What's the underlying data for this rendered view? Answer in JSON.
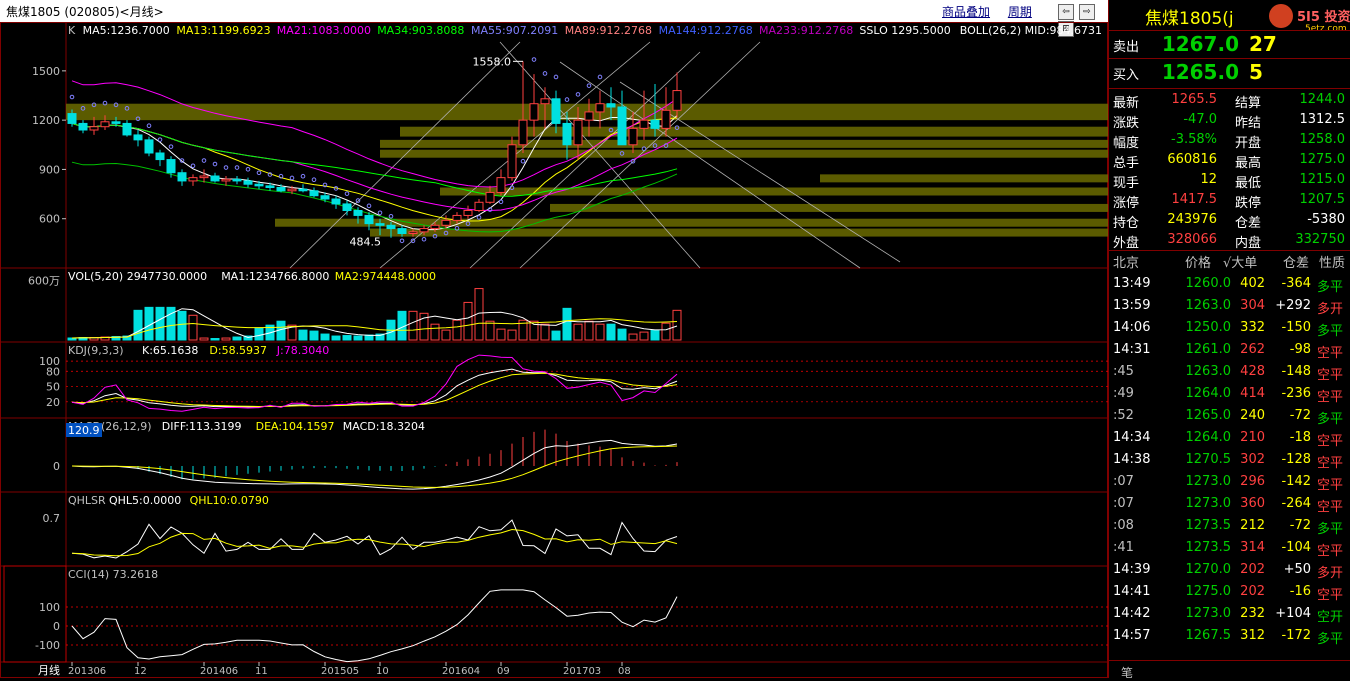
{
  "window": {
    "title": "焦煤1805 (020805)<月线>",
    "links": [
      "商品叠加",
      "周期"
    ],
    "nav_buttons": [
      "⇦",
      "⇨",
      "⊞"
    ]
  },
  "panels": {
    "main": {
      "legend": [
        {
          "text": "K",
          "color": "#c0c0c0"
        },
        {
          "text": "MA5:1236.7000",
          "color": "#ffffff"
        },
        {
          "text": "MA13:1199.6923",
          "color": "#ffff00"
        },
        {
          "text": "MA21:1083.0000",
          "color": "#ff00ff"
        },
        {
          "text": "MA34:903.8088",
          "color": "#00ff00"
        },
        {
          "text": "MA55:907.2091",
          "color": "#8080ff"
        },
        {
          "text": "MA89:912.2768",
          "color": "#ff8080"
        },
        {
          "text": "MA144:912.2768",
          "color": "#4060ff"
        },
        {
          "text": "MA233:912.2768",
          "color": "#c000c0"
        },
        {
          "text": "SSLO 1295.5000",
          "color": "#ffffff"
        },
        {
          "text": "BOLL(26,2) MID:984.6731",
          "color": "#ffffff"
        }
      ],
      "yticks": [
        "1500",
        "1200",
        "900",
        "600"
      ],
      "annotations": {
        "high": "1558.0",
        "low": "484.5"
      }
    },
    "vol": {
      "legend": [
        {
          "text": "VOL(5,20) 2947730.0000",
          "color": "#ffffff"
        },
        {
          "text": "MA1:1234766.8000",
          "color": "#ffffff"
        },
        {
          "text": "MA2:974448.0000",
          "color": "#ffff00"
        }
      ],
      "ytick": "600万"
    },
    "kdj": {
      "legend": [
        {
          "text": "KDJ(9,3,3)",
          "color": "#c0c0c0"
        },
        {
          "text": "K:65.1638",
          "color": "#ffffff"
        },
        {
          "text": "D:58.5937",
          "color": "#ffff00"
        },
        {
          "text": "J:78.3040",
          "color": "#ff00ff"
        }
      ],
      "yticks": [
        "100",
        "80",
        "50",
        "20"
      ]
    },
    "macd": {
      "legend": [
        {
          "text": "MACD(26,12,9)",
          "color": "#c0c0c0"
        },
        {
          "text": "DIFF:113.3199",
          "color": "#ffffff"
        },
        {
          "text": "DEA:104.1597",
          "color": "#ffff00"
        },
        {
          "text": "MACD:18.3204",
          "color": "#ffffff"
        }
      ],
      "yticks": [
        "0"
      ],
      "cursor_value": "120.9"
    },
    "qhlsr": {
      "legend": [
        {
          "text": "QHLSR",
          "color": "#c0c0c0"
        },
        {
          "text": "QHL5:0.0000",
          "color": "#ffffff"
        },
        {
          "text": "QHL10:0.0790",
          "color": "#ffff00"
        }
      ],
      "yticks": [
        "0.7"
      ]
    },
    "cci": {
      "legend": [
        {
          "text": "CCI(14) 73.2618",
          "color": "#c0c0c0"
        }
      ],
      "yticks": [
        "100",
        "0",
        "-100"
      ]
    }
  },
  "xaxis": {
    "period_label": "月线",
    "labels": [
      "201306",
      "12",
      "201406",
      "11",
      "201505",
      "10",
      "201604",
      "09",
      "201703",
      "08"
    ]
  },
  "quote": {
    "name": "焦煤1805(j",
    "brand": "5I5 投资",
    "brand_sub": "5etz.com",
    "sell_label": "卖出",
    "sell_price": "1267.0",
    "sell_vol": "27",
    "buy_label": "买入",
    "buy_price": "1265.0",
    "buy_vol": "5",
    "stats": [
      {
        "l1": "最新",
        "v1": "1265.5",
        "c1": "#ff4040",
        "l2": "结算",
        "v2": "1244.0",
        "c2": "#00d000"
      },
      {
        "l1": "涨跌",
        "v1": "-47.0",
        "c1": "#00d000",
        "l2": "昨结",
        "v2": "1312.5",
        "c2": "#ffffff"
      },
      {
        "l1": "幅度",
        "v1": "-3.58%",
        "c1": "#00d000",
        "l2": "开盘",
        "v2": "1258.0",
        "c2": "#00d000"
      },
      {
        "l1": "总手",
        "v1": "660816",
        "c1": "#ffff00",
        "l2": "最高",
        "v2": "1275.0",
        "c2": "#00d000"
      },
      {
        "l1": "现手",
        "v1": "12",
        "c1": "#ffff00",
        "l2": "最低",
        "v2": "1215.0",
        "c2": "#00d000"
      },
      {
        "l1": "涨停",
        "v1": "1417.5",
        "c1": "#ff4040",
        "l2": "跌停",
        "v2": "1207.5",
        "c2": "#00d000"
      },
      {
        "l1": "持仓",
        "v1": "243976",
        "c1": "#ffff00",
        "l2": "仓差",
        "v2": "-5380",
        "c2": "#ffffff"
      },
      {
        "l1": "外盘",
        "v1": "328066",
        "c1": "#ff4040",
        "l2": "内盘",
        "v2": "332750",
        "c2": "#00d000"
      }
    ],
    "trade_header": {
      "loc": "北京",
      "price": "价格",
      "big": "√大单",
      "pos": "仓差",
      "nature": "性质"
    },
    "trades": [
      {
        "time": "13:49",
        "price": "1260.0",
        "vol": "402",
        "diff": "-364",
        "nature": "多平",
        "tc": "#ffffff",
        "pc": "#00d000",
        "vc": "#ffff00",
        "dc": "#ffff00",
        "nc": "#00d000"
      },
      {
        "time": "13:59",
        "price": "1263.0",
        "vol": "304",
        "diff": "+292",
        "nature": "多开",
        "tc": "#ffffff",
        "pc": "#00d000",
        "vc": "#ff4040",
        "dc": "#ffffff",
        "nc": "#ff4040"
      },
      {
        "time": "14:06",
        "price": "1250.0",
        "vol": "332",
        "diff": "-150",
        "nature": "多平",
        "tc": "#ffffff",
        "pc": "#00d000",
        "vc": "#ffff00",
        "dc": "#ffff00",
        "nc": "#00d000"
      },
      {
        "time": "14:31",
        "price": "1261.0",
        "vol": "262",
        "diff": "-98",
        "nature": "空平",
        "tc": "#ffffff",
        "pc": "#00d000",
        "vc": "#ff4040",
        "dc": "#ffff00",
        "nc": "#ff4040"
      },
      {
        "time": ":45",
        "price": "1263.0",
        "vol": "428",
        "diff": "-148",
        "nature": "空平",
        "tc": "#c0c0c0",
        "pc": "#00d000",
        "vc": "#ff4040",
        "dc": "#ffff00",
        "nc": "#ff4040"
      },
      {
        "time": ":49",
        "price": "1264.0",
        "vol": "414",
        "diff": "-236",
        "nature": "空平",
        "tc": "#c0c0c0",
        "pc": "#00d000",
        "vc": "#ff4040",
        "dc": "#ffff00",
        "nc": "#ff4040"
      },
      {
        "time": ":52",
        "price": "1265.0",
        "vol": "240",
        "diff": "-72",
        "nature": "多平",
        "tc": "#c0c0c0",
        "pc": "#00d000",
        "vc": "#ffff00",
        "dc": "#ffff00",
        "nc": "#00d000"
      },
      {
        "time": "14:34",
        "price": "1264.0",
        "vol": "210",
        "diff": "-18",
        "nature": "空平",
        "tc": "#ffffff",
        "pc": "#00d000",
        "vc": "#ff4040",
        "dc": "#ffff00",
        "nc": "#ff4040"
      },
      {
        "time": "14:38",
        "price": "1270.5",
        "vol": "302",
        "diff": "-128",
        "nature": "空平",
        "tc": "#ffffff",
        "pc": "#00d000",
        "vc": "#ff4040",
        "dc": "#ffff00",
        "nc": "#ff4040"
      },
      {
        "time": ":07",
        "price": "1273.0",
        "vol": "296",
        "diff": "-142",
        "nature": "空平",
        "tc": "#c0c0c0",
        "pc": "#00d000",
        "vc": "#ff4040",
        "dc": "#ffff00",
        "nc": "#ff4040"
      },
      {
        "time": ":07",
        "price": "1273.0",
        "vol": "360",
        "diff": "-264",
        "nature": "空平",
        "tc": "#c0c0c0",
        "pc": "#00d000",
        "vc": "#ff4040",
        "dc": "#ffff00",
        "nc": "#ff4040"
      },
      {
        "time": ":08",
        "price": "1273.5",
        "vol": "212",
        "diff": "-72",
        "nature": "多平",
        "tc": "#c0c0c0",
        "pc": "#00d000",
        "vc": "#ffff00",
        "dc": "#ffff00",
        "nc": "#00d000"
      },
      {
        "time": ":41",
        "price": "1273.5",
        "vol": "314",
        "diff": "-104",
        "nature": "空平",
        "tc": "#c0c0c0",
        "pc": "#00d000",
        "vc": "#ff4040",
        "dc": "#ffff00",
        "nc": "#ff4040"
      },
      {
        "time": "14:39",
        "price": "1270.0",
        "vol": "202",
        "diff": "+50",
        "nature": "多开",
        "tc": "#ffffff",
        "pc": "#00d000",
        "vc": "#ff4040",
        "dc": "#ffffff",
        "nc": "#ff4040"
      },
      {
        "time": "14:41",
        "price": "1275.0",
        "vol": "202",
        "diff": "-16",
        "nature": "空平",
        "tc": "#ffffff",
        "pc": "#00d000",
        "vc": "#ff4040",
        "dc": "#ffff00",
        "nc": "#ff4040"
      },
      {
        "time": "14:42",
        "price": "1273.0",
        "vol": "232",
        "diff": "+104",
        "nature": "空开",
        "tc": "#ffffff",
        "pc": "#00d000",
        "vc": "#ffff00",
        "dc": "#ffffff",
        "nc": "#00d000"
      },
      {
        "time": "14:57",
        "price": "1267.5",
        "vol": "312",
        "diff": "-172",
        "nature": "多平",
        "tc": "#ffffff",
        "pc": "#00d000",
        "vc": "#ffff00",
        "dc": "#ffff00",
        "nc": "#00d000"
      }
    ],
    "footer_label": "笔"
  },
  "chart_data": {
    "type": "candlestick",
    "period": "monthly",
    "x": [
      "201306",
      "201307",
      "201308",
      "201309",
      "201310",
      "201311",
      "201312",
      "201401",
      "201402",
      "201403",
      "201404",
      "201405",
      "201406",
      "201407",
      "201408",
      "201409",
      "201410",
      "201411",
      "201412",
      "201501",
      "201502",
      "201503",
      "201504",
      "201505",
      "201506",
      "201507",
      "201508",
      "201509",
      "201510",
      "201511",
      "201512",
      "201601",
      "201602",
      "201603",
      "201604",
      "201605",
      "201606",
      "201607",
      "201608",
      "201609",
      "201610",
      "201611",
      "201612",
      "201701",
      "201702",
      "201703",
      "201704",
      "201705",
      "201706",
      "201707",
      "201708",
      "201709",
      "201710",
      "201711",
      "201712",
      "201801"
    ],
    "open": [
      1240,
      1180,
      1140,
      1160,
      1190,
      1180,
      1110,
      1080,
      1000,
      960,
      880,
      830,
      850,
      860,
      830,
      840,
      830,
      810,
      800,
      790,
      770,
      780,
      770,
      740,
      720,
      690,
      650,
      620,
      570,
      560,
      540,
      510,
      520,
      540,
      560,
      590,
      620,
      650,
      700,
      760,
      850,
      1050,
      1200,
      1300,
      1330,
      1180,
      1050,
      1200,
      1250,
      1300,
      1280,
      1050,
      1150,
      1200,
      1150,
      1260
    ],
    "high": [
      1265,
      1200,
      1220,
      1230,
      1220,
      1200,
      1140,
      1100,
      1020,
      980,
      900,
      870,
      900,
      880,
      860,
      860,
      850,
      830,
      820,
      810,
      800,
      810,
      790,
      760,
      740,
      710,
      670,
      640,
      600,
      580,
      560,
      540,
      560,
      580,
      620,
      640,
      680,
      720,
      800,
      900,
      1100,
      1558,
      1480,
      1400,
      1380,
      1250,
      1280,
      1330,
      1380,
      1400,
      1380,
      1250,
      1380,
      1420,
      1400,
      1490
    ],
    "low": [
      1160,
      1120,
      1110,
      1140,
      1160,
      1100,
      1040,
      980,
      920,
      850,
      800,
      800,
      820,
      820,
      800,
      810,
      790,
      780,
      770,
      760,
      750,
      760,
      730,
      700,
      660,
      620,
      570,
      530,
      500,
      484.5,
      490,
      490,
      500,
      520,
      540,
      570,
      600,
      640,
      690,
      740,
      830,
      1000,
      1100,
      1150,
      1120,
      960,
      960,
      1100,
      1150,
      1200,
      1050,
      1000,
      1080,
      1100,
      1100,
      1215
    ],
    "close": [
      1180,
      1140,
      1160,
      1190,
      1180,
      1110,
      1080,
      1000,
      960,
      880,
      830,
      850,
      860,
      830,
      840,
      830,
      810,
      800,
      790,
      770,
      780,
      770,
      740,
      720,
      690,
      650,
      620,
      570,
      560,
      540,
      510,
      520,
      540,
      560,
      590,
      620,
      650,
      700,
      760,
      850,
      1050,
      1200,
      1300,
      1330,
      1180,
      1050,
      1200,
      1250,
      1300,
      1280,
      1050,
      1150,
      1200,
      1150,
      1260,
      1380
    ],
    "ylim": [
      300,
      1700
    ],
    "volume_wan": [
      20,
      25,
      25,
      30,
      35,
      40,
      300,
      330,
      330,
      330,
      290,
      250,
      20,
      15,
      20,
      30,
      40,
      120,
      150,
      190,
      150,
      100,
      90,
      60,
      40,
      45,
      40,
      50,
      60,
      200,
      290,
      290,
      270,
      160,
      100,
      200,
      380,
      520,
      190,
      110,
      100,
      200,
      190,
      160,
      90,
      320,
      160,
      190,
      160,
      160,
      110,
      60,
      80,
      100,
      170,
      300
    ],
    "indicators": {
      "MA5": 1236.7,
      "MA13": 1199.6923,
      "MA21": 1083.0,
      "MA34": 903.8088,
      "MA55": 907.2091,
      "MA89": 912.2768,
      "MA144": 912.2768,
      "MA233": 912.2768,
      "SSLO": 1295.5,
      "BOLL_MID": 984.6731,
      "VOL": 2947730.0,
      "VOL_MA1": 1234766.8,
      "VOL_MA2": 974448.0,
      "K": 65.1638,
      "D": 58.5937,
      "J": 78.304,
      "DIFF": 113.3199,
      "DEA": 104.1597,
      "MACD": 18.3204,
      "QHL5": 0.0,
      "QHL10": 0.079,
      "CCI": 73.2618
    },
    "resistance_zones": [
      [
        1200,
        1300
      ],
      [
        1100,
        1160
      ],
      [
        1050,
        1080
      ],
      [
        980,
        1020
      ],
      [
        830,
        870
      ],
      [
        750,
        790
      ],
      [
        650,
        690
      ],
      [
        560,
        600
      ],
      [
        500,
        540
      ]
    ]
  }
}
